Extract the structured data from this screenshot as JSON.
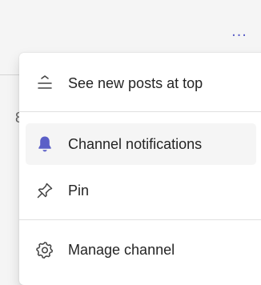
{
  "header": {
    "more_options_label": "..."
  },
  "menu": {
    "items": [
      {
        "label": "See new posts at top",
        "icon": "sort-newest-top-icon"
      },
      {
        "label": "Channel notifications",
        "icon": "bell-icon",
        "highlighted": true
      },
      {
        "label": "Pin",
        "icon": "pin-icon"
      },
      {
        "label": "Manage channel",
        "icon": "gear-icon"
      }
    ]
  },
  "colors": {
    "accent": "#5b5fc7",
    "text": "#242424",
    "hover_bg": "#f5f5f5"
  }
}
